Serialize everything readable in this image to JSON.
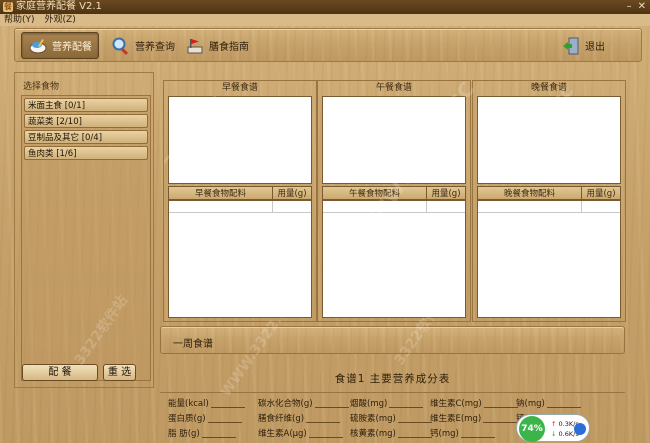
{
  "window": {
    "title": "家庭营养配餐 V2.1"
  },
  "menu": {
    "items": [
      "帮助(Y)",
      "外观(Z)"
    ]
  },
  "toolbar": {
    "nutrition_label": "营养配餐",
    "query_label": "营养查询",
    "guide_label": "膳食指南",
    "exit_label": "退出"
  },
  "left": {
    "title": "选择食物",
    "categories": [
      "米面主食 [0/1]",
      "蔬菜类 [2/10]",
      "豆制品及其它 [0/4]",
      "鱼肉类 [1/6]"
    ],
    "match_label": "配 餐",
    "reselect_label": "重 选"
  },
  "meals": {
    "breakfast": {
      "title": "早餐食谱",
      "col_ingredient": "早餐食物配料",
      "col_amount": "用量(g)"
    },
    "lunch": {
      "title": "午餐食谱",
      "col_ingredient": "午餐食物配料",
      "col_amount": "用量(g)"
    },
    "dinner": {
      "title": "晚餐食谱",
      "col_ingredient": "晚餐食物配料",
      "col_amount": "用量(g)"
    }
  },
  "weekly": {
    "label": "一周食谱"
  },
  "nutrition": {
    "title": "食谱1 主要营养成分表",
    "items": [
      "能量(kcal)",
      "碳水化合物(g)",
      "烟酸(mg)",
      "维生素C(mg)",
      "钠(mg)",
      "蛋白质(g)",
      "膳食纤维(g)",
      "硫胺素(mg)",
      "维生素E(mg)",
      "钙(mg)",
      "脂 肪(g)",
      "维生素A(μg)",
      "核黄素(mg)",
      "钙(mg)",
      ""
    ]
  },
  "net": {
    "percent": "74%",
    "up": "0.3K/s",
    "down": "0.6K/s"
  },
  "watermarks": [
    "3322.cc",
    "WWW.3322.CC",
    "3322软件站",
    "3322软件站",
    "WWW.3322.CC",
    "3322.cc"
  ]
}
